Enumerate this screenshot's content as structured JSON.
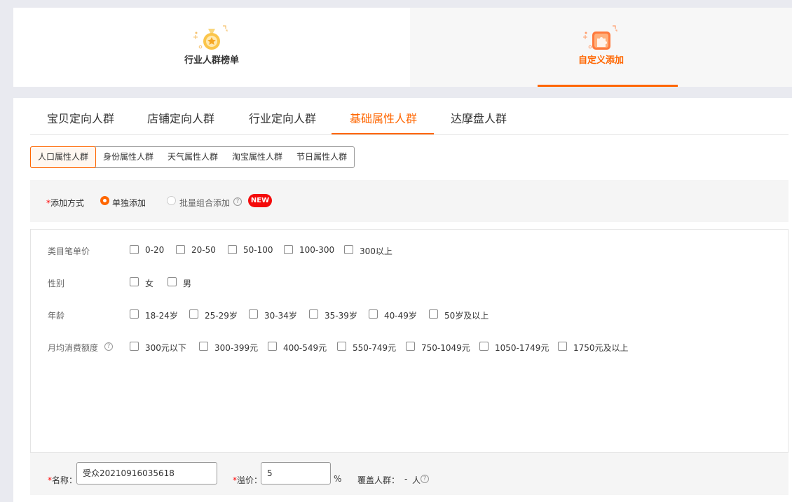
{
  "top_tabs": [
    {
      "label": "行业人群榜单",
      "icon": "medal-icon",
      "active": false
    },
    {
      "label": "自定义添加",
      "icon": "puzzle-icon",
      "active": true
    }
  ],
  "tabs": [
    "宝贝定向人群",
    "店铺定向人群",
    "行业定向人群",
    "基础属性人群",
    "达摩盘人群"
  ],
  "active_tab": "基础属性人群",
  "subtabs": [
    "人口属性人群",
    "身份属性人群",
    "天气属性人群",
    "淘宝属性人群",
    "节日属性人群"
  ],
  "active_subtab": "人口属性人群",
  "add_method": {
    "required_mark": "*",
    "label": "添加方式",
    "options": [
      "单独添加",
      "批量组合添加"
    ],
    "selected": "单独添加",
    "help_icon": "question-icon",
    "badge": "NEW"
  },
  "attributes": [
    {
      "label": "类目笔单价",
      "options": [
        "0-20",
        "20-50",
        "50-100",
        "100-300",
        "300以上"
      ]
    },
    {
      "label": "性别",
      "options": [
        "女",
        "男"
      ]
    },
    {
      "label": "年龄",
      "options": [
        "18-24岁",
        "25-29岁",
        "30-34岁",
        "35-39岁",
        "40-49岁",
        "50岁及以上"
      ]
    },
    {
      "label": "月均消费额度",
      "help_icon": "question-icon",
      "options": [
        "300元以下",
        "300-399元",
        "400-549元",
        "550-749元",
        "750-1049元",
        "1050-1749元",
        "1750元及以上"
      ]
    }
  ],
  "bottom": {
    "name_label": "名称：",
    "name_value": "受众20210916035618",
    "premium_label": "溢价：",
    "premium_value": "5",
    "premium_unit": "%",
    "coverage_label": "覆盖人群：",
    "coverage_value": "-",
    "coverage_unit": "人",
    "required_mark": "*"
  },
  "colors": {
    "accent": "#ff6600",
    "badge": "#f40a0a"
  }
}
